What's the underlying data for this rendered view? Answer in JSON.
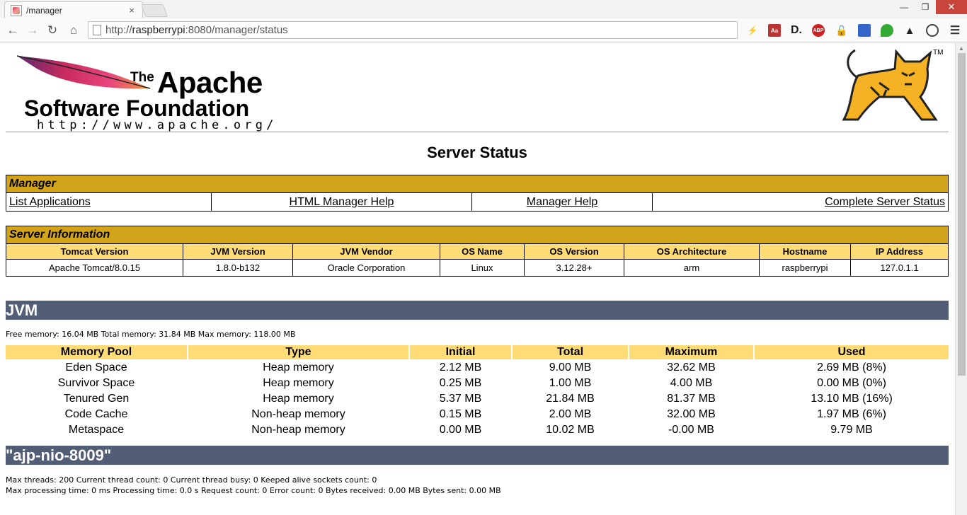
{
  "browser": {
    "tab_title": "/manager",
    "tab_close": "×",
    "url_prefix": "http://",
    "url_host": "raspberrypi",
    "url_rest": ":8080/manager/status",
    "win_min": "—",
    "win_max": "❐",
    "win_close": "✕",
    "ext_d": "D.",
    "ext_abp": "ABP"
  },
  "logo": {
    "the": "The",
    "apache": "Apache",
    "software_foundation": "Software Foundation",
    "url": "http://www.apache.org/",
    "tm": "TM"
  },
  "title": "Server Status",
  "manager": {
    "heading": "Manager",
    "links": [
      "List Applications",
      "HTML Manager Help",
      "Manager Help",
      "Complete Server Status"
    ]
  },
  "server_info": {
    "heading": "Server Information",
    "columns": [
      "Tomcat Version",
      "JVM Version",
      "JVM Vendor",
      "OS Name",
      "OS Version",
      "OS Architecture",
      "Hostname",
      "IP Address"
    ],
    "values": [
      "Apache Tomcat/8.0.15",
      "1.8.0-b132",
      "Oracle Corporation",
      "Linux",
      "3.12.28+",
      "arm",
      "raspberrypi",
      "127.0.1.1"
    ]
  },
  "jvm": {
    "heading": "JVM",
    "memory_line": "Free memory: 16.04 MB Total memory: 31.84 MB Max memory: 118.00 MB",
    "columns": [
      "Memory Pool",
      "Type",
      "Initial",
      "Total",
      "Maximum",
      "Used"
    ],
    "rows": [
      [
        "Eden Space",
        "Heap memory",
        "2.12 MB",
        "9.00 MB",
        "32.62 MB",
        "2.69 MB (8%)"
      ],
      [
        "Survivor Space",
        "Heap memory",
        "0.25 MB",
        "1.00 MB",
        "4.00 MB",
        "0.00 MB (0%)"
      ],
      [
        "Tenured Gen",
        "Heap memory",
        "5.37 MB",
        "21.84 MB",
        "81.37 MB",
        "13.10 MB (16%)"
      ],
      [
        "Code Cache",
        "Non-heap memory",
        "0.15 MB",
        "2.00 MB",
        "32.00 MB",
        "1.97 MB (6%)"
      ],
      [
        "Metaspace",
        "Non-heap memory",
        "0.00 MB",
        "10.02 MB",
        "-0.00 MB",
        "9.79 MB"
      ]
    ]
  },
  "connector": {
    "heading": "\"ajp-nio-8009\"",
    "line1": "Max threads: 200 Current thread count: 0 Current thread busy: 0 Keeped alive sockets count: 0",
    "line2": "Max processing time: 0 ms Processing time: 0.0 s Request count: 0 Error count: 0 Bytes received: 0.00 MB Bytes sent: 0.00 MB"
  },
  "colors": {
    "section_gold": "#d2a41c",
    "header_yellow": "#ffdc75",
    "bar_slate": "#525d76"
  }
}
